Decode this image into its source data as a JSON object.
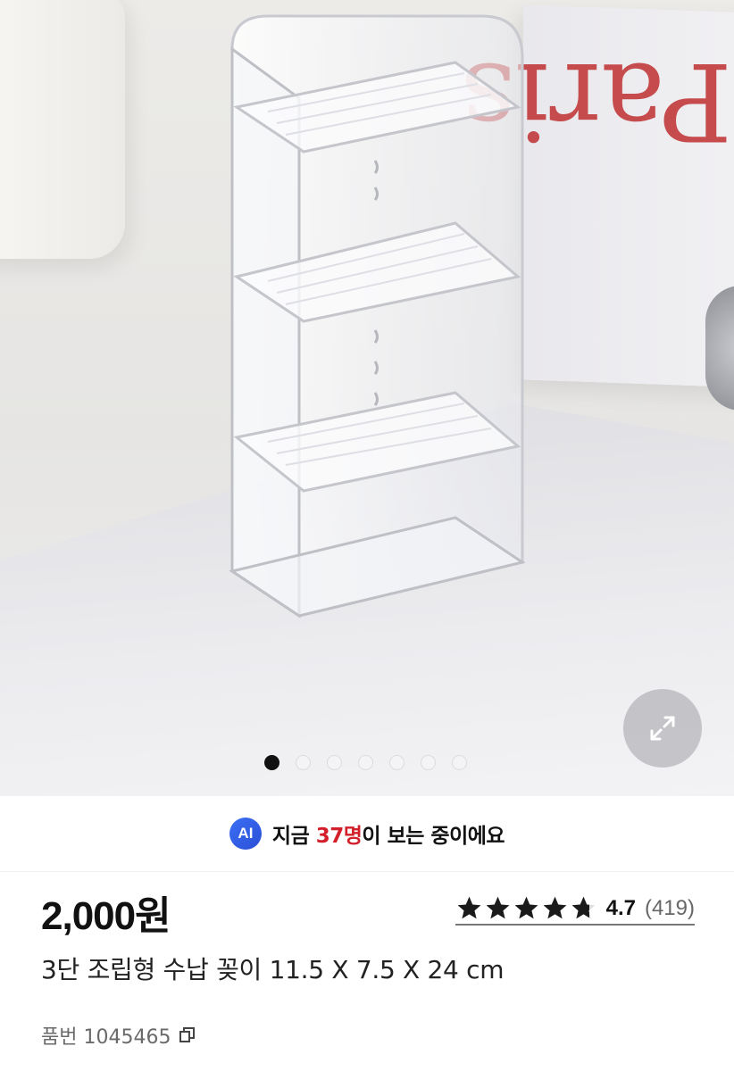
{
  "gallery": {
    "image_alt": "3단 조립형 수납 꽂이",
    "slide_count": 7,
    "active_slide": 1,
    "expand_icon": "expand-arrows-icon"
  },
  "ai_banner": {
    "badge": "AI",
    "prefix": "지금 ",
    "highlight": "37명",
    "suffix": "이 보는 중이에요",
    "highlight_color": "#d21f2a"
  },
  "product": {
    "price": "2,000원",
    "rating_value": "4.7",
    "rating_count": "(419)",
    "rating_stars": 4.7,
    "title": "3단 조립형 수납 꽂이 11.5 X 7.5 X 24 cm",
    "sku_label": "품번 1045465",
    "copy_icon": "copy-icon"
  }
}
